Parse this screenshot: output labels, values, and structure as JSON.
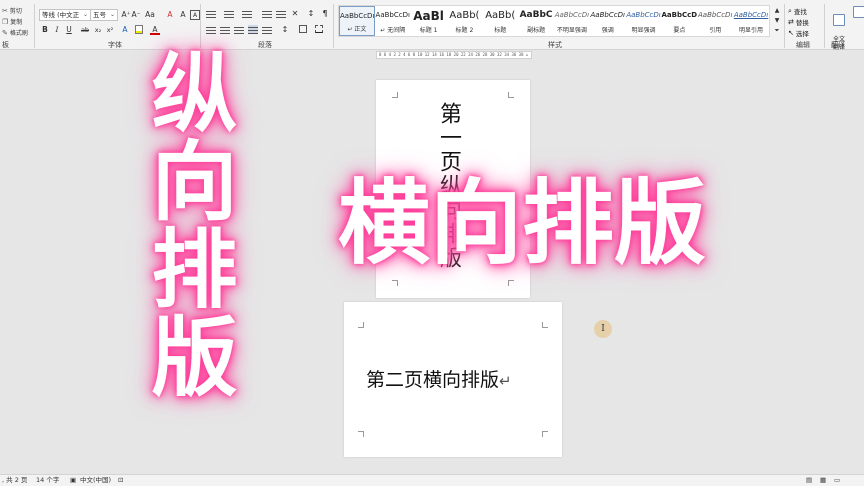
{
  "clipboard": {
    "cut": "剪切",
    "copy": "复制",
    "format_painter": "格式刷",
    "group_label": "板"
  },
  "font": {
    "name": "等线 (中文正",
    "size": "五号",
    "group_label": "字体",
    "buttons": [
      "A⁺",
      "A⁻",
      "Aa",
      "A",
      "B",
      "I",
      "U",
      "ab",
      "x₂",
      "x²",
      "A",
      "A",
      "A",
      "A"
    ]
  },
  "paragraph": {
    "group_label": "段落"
  },
  "styles": {
    "group_label": "样式",
    "items": [
      {
        "preview": "AaBbCcDı",
        "name": "正文",
        "selected": true
      },
      {
        "preview": "AaBbCcDı",
        "name": "无间隔"
      },
      {
        "preview": "AaBl",
        "name": "标题 1"
      },
      {
        "preview": "AaBb(",
        "name": "标题 2"
      },
      {
        "preview": "AaBb(",
        "name": "标题"
      },
      {
        "preview": "AaBbC",
        "name": "副标题"
      },
      {
        "preview": "AaBbCcDı",
        "name": "不明显强调"
      },
      {
        "preview": "AaBbCcDı",
        "name": "强调"
      },
      {
        "preview": "AaBbCcDı",
        "name": "明显强调"
      },
      {
        "preview": "AaBbCcDı",
        "name": "要点"
      },
      {
        "preview": "AaBbCcDı",
        "name": "引用"
      },
      {
        "preview": "AaBbCcDı",
        "name": "明显引用"
      }
    ]
  },
  "editing": {
    "find": "查找",
    "replace": "替换",
    "select": "选择",
    "group_label": "编辑"
  },
  "translate": {
    "full_text": "全文\n翻译",
    "group_label": "翻译"
  },
  "ruler_text": "8 6 4 2  2 4 6 8 10 12 14 16 18 20 22 24 26 28 30 32 34 36 38 ⊥ 42 44 46 48",
  "document": {
    "page1_text": "第一页纵向排版",
    "page2_text": "第二页横向排版",
    "para_mark": "↵"
  },
  "overlay": {
    "vertical": "纵向排版",
    "horizontal": "横向排版"
  },
  "status": {
    "pages": ", 共 2 页",
    "words": "14 个字",
    "language": "中文(中国)"
  },
  "colors": {
    "glow": "#ff3d9a",
    "ribbon_bg": "#f3f3f3",
    "canvas_bg": "#e6e6e6"
  }
}
